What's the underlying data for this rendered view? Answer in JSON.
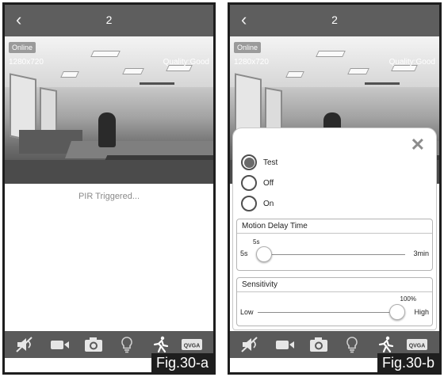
{
  "panel_a": {
    "header": {
      "back_icon": "chevron-left-icon",
      "title": "2"
    },
    "video": {
      "status": "Online",
      "resolution": "1280x720",
      "quality": "Quality:Good"
    },
    "message": "PIR Triggered...",
    "toolbar": [
      "mute-icon",
      "video-record-icon",
      "snapshot-camera-icon",
      "light-bulb-icon",
      "running-man-icon",
      "qvga-icon"
    ],
    "qvga_label": "QVGA",
    "fig_label": "Fig.30-a"
  },
  "panel_b": {
    "header": {
      "back_icon": "chevron-left-icon",
      "title": "2"
    },
    "video": {
      "status": "Online",
      "resolution": "1280x720",
      "quality": "Quality:Good"
    },
    "sheet": {
      "close_icon": "close-x-icon",
      "options": [
        {
          "label": "Test",
          "selected": true
        },
        {
          "label": "Off",
          "selected": false
        },
        {
          "label": "On",
          "selected": false
        }
      ],
      "motion_delay": {
        "title": "Motion Delay Time",
        "min": "5s",
        "max": "3min",
        "value_label": "5s",
        "position": 0.0
      },
      "sensitivity": {
        "title": "Sensitivity",
        "min": "Low",
        "max": "High",
        "value_label": "100%",
        "position": 1.0
      }
    },
    "toolbar": [
      "mute-icon",
      "video-record-icon",
      "snapshot-camera-icon",
      "light-bulb-icon",
      "running-man-icon",
      "qvga-icon"
    ],
    "qvga_label": "QVGA",
    "fig_label": "Fig.30-b"
  },
  "colors": {
    "header": "#5e5e5e",
    "toolbar": "#5a5a5a",
    "frame": "#1e1e1e",
    "status_badge": "#9a9a9a"
  }
}
